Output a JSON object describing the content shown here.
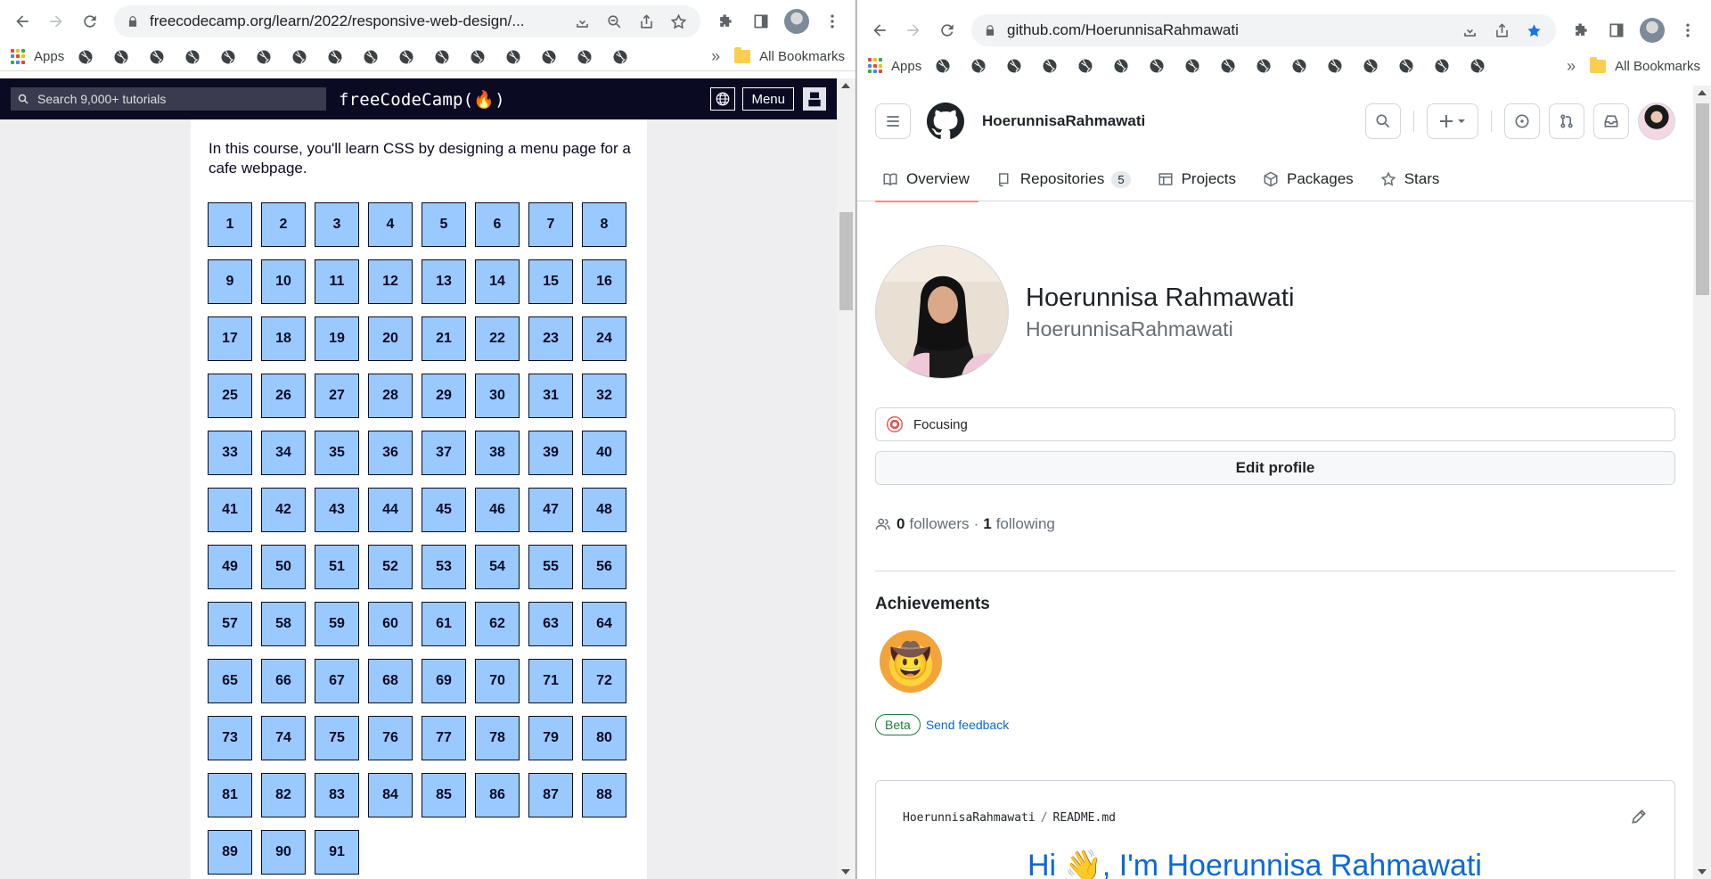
{
  "left_window": {
    "url": "freecodecamp.org/learn/2022/responsive-web-design/...",
    "bookmarks": {
      "apps_label": "Apps",
      "all_bookmarks": "All Bookmarks",
      "more": "»"
    },
    "fcc": {
      "search_placeholder": "Search 9,000+ tutorials",
      "logo": "freeCodeCamp(🔥)",
      "menu_label": "Menu",
      "intro": "In this course, you'll learn CSS by designing a menu page for a cafe webpage.",
      "steps": [
        "1",
        "2",
        "3",
        "4",
        "5",
        "6",
        "7",
        "8",
        "9",
        "10",
        "11",
        "12",
        "13",
        "14",
        "15",
        "16",
        "17",
        "18",
        "19",
        "20",
        "21",
        "22",
        "23",
        "24",
        "25",
        "26",
        "27",
        "28",
        "29",
        "30",
        "31",
        "32",
        "33",
        "34",
        "35",
        "36",
        "37",
        "38",
        "39",
        "40",
        "41",
        "42",
        "43",
        "44",
        "45",
        "46",
        "47",
        "48",
        "49",
        "50",
        "51",
        "52",
        "53",
        "54",
        "55",
        "56",
        "57",
        "58",
        "59",
        "60",
        "61",
        "62",
        "63",
        "64",
        "65",
        "66",
        "67",
        "68",
        "69",
        "70",
        "71",
        "72",
        "73",
        "74",
        "75",
        "76",
        "77",
        "78",
        "79",
        "80",
        "81",
        "82",
        "83",
        "84",
        "85",
        "86",
        "87",
        "88",
        "89",
        "90",
        "91"
      ]
    }
  },
  "right_window": {
    "url": "github.com/HoerunnisaRahmawati",
    "bookmarks": {
      "apps_label": "Apps",
      "all_bookmarks": "All Bookmarks",
      "more": "»"
    },
    "github": {
      "header_username": "HoerunnisaRahmawati",
      "tabs": [
        {
          "label": "Overview",
          "icon": "book-icon"
        },
        {
          "label": "Repositories",
          "icon": "repo-icon",
          "count": "5"
        },
        {
          "label": "Projects",
          "icon": "table-icon"
        },
        {
          "label": "Packages",
          "icon": "package-icon"
        },
        {
          "label": "Stars",
          "icon": "star-icon"
        }
      ],
      "name": "Hoerunnisa Rahmawati",
      "login": "HoerunnisaRahmawati",
      "status": "Focusing",
      "edit_profile": "Edit profile",
      "followers_count": "0",
      "followers_label": "followers",
      "separator": "·",
      "following_count": "1",
      "following_label": "following",
      "achievements_title": "Achievements",
      "beta_label": "Beta",
      "feedback_label": "Send feedback",
      "readme_owner": "HoerunnisaRahmawati",
      "readme_sep": "/",
      "readme_file": "README.md",
      "readme_heading": "Hi 👋, I'm Hoerunnisa Rahmawati"
    }
  },
  "colors": {
    "fcc_navy": "#0a0a23",
    "fcc_step": "#99c9ff",
    "gh_link": "#0969da",
    "gh_tab_underline": "#fd8c73",
    "star_active": "#1a73e8"
  }
}
